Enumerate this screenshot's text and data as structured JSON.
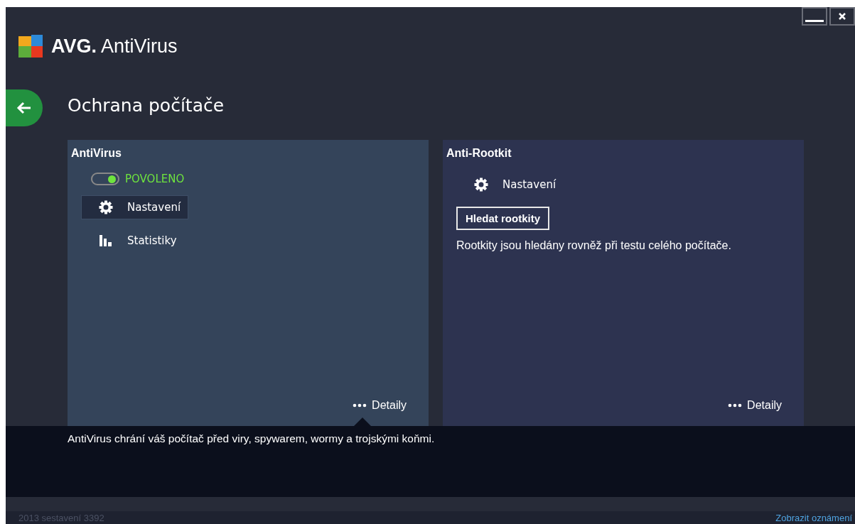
{
  "window": {
    "brand": "AVG.",
    "product": "AntiVirus"
  },
  "page": {
    "title": "Ochrana počítače"
  },
  "panels": [
    {
      "title": "AntiVirus",
      "selected": true,
      "items": [
        {
          "kind": "toggle",
          "label": "POVOLENO",
          "on": true
        },
        {
          "kind": "settings",
          "label": "Nastavení",
          "selected": true
        },
        {
          "kind": "stats",
          "label": "Statistiky",
          "selected": false
        }
      ],
      "details": "Detaily"
    },
    {
      "title": "Anti-Rootkit",
      "selected": false,
      "items": [
        {
          "kind": "settings",
          "label": "Nastavení",
          "selected": false
        },
        {
          "kind": "button",
          "label": "Hledat rootkity"
        },
        {
          "kind": "text",
          "label": "Rootkity jsou hledány rovněž při testu celého počítače."
        }
      ],
      "details": "Detaily"
    }
  ],
  "description": "AntiVirus chrání váš počítač před viry, spywarem, wormy a trojskými koňmi.",
  "status_bar": {
    "build": "2013  sestavení 3392",
    "link": "Zobrazit oznámení"
  }
}
